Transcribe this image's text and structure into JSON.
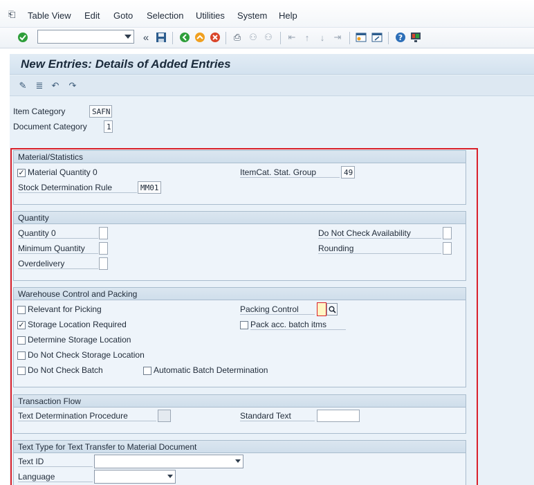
{
  "menu": {
    "items": [
      "Table View",
      "Edit",
      "Goto",
      "Selection",
      "Utilities",
      "System",
      "Help"
    ]
  },
  "toolbar": {
    "icons": [
      "checkmark-icon",
      "back-chevrons-icon",
      "save-icon",
      "back-icon",
      "exit-icon",
      "cancel-icon",
      "print-icon",
      "find-icon",
      "find-next-icon",
      "first-page-icon",
      "prev-page-icon",
      "next-page-icon",
      "last-page-icon",
      "new-session-icon",
      "shortcut-icon",
      "help-icon",
      "customize-layout-icon"
    ],
    "command_value": ""
  },
  "title": "New Entries: Details of Added Entries",
  "header_fields": {
    "item_category": {
      "label": "Item Category",
      "value": "SAFN"
    },
    "document_category": {
      "label": "Document Category",
      "value": "1"
    }
  },
  "material_statistics": {
    "header": "Material/Statistics",
    "material_quantity_0": {
      "label": "Material Quantity 0",
      "checked": true
    },
    "itemcat_stat_group": {
      "label": "ItemCat. Stat. Group",
      "value": "49"
    },
    "stock_determination_rule": {
      "label": "Stock Determination Rule",
      "value": "MM01"
    }
  },
  "quantity": {
    "header": "Quantity",
    "quantity_0": {
      "label": "Quantity 0",
      "value": ""
    },
    "minimum_quantity": {
      "label": "Minimum Quantity",
      "value": ""
    },
    "overdelivery": {
      "label": "Overdelivery",
      "value": ""
    },
    "do_not_check_availability": {
      "label": "Do Not Check Availability",
      "value": ""
    },
    "rounding": {
      "label": "Rounding",
      "value": ""
    }
  },
  "warehouse": {
    "header": "Warehouse Control and Packing",
    "relevant_for_picking": {
      "label": "Relevant for Picking",
      "checked": false
    },
    "storage_location_required": {
      "label": "Storage Location Required",
      "checked": true
    },
    "determine_storage_location": {
      "label": "Determine Storage Location",
      "checked": false
    },
    "do_not_check_storage_location": {
      "label": "Do Not Check Storage Location",
      "checked": false
    },
    "do_not_check_batch": {
      "label": "Do Not Check Batch",
      "checked": false
    },
    "automatic_batch_determination": {
      "label": "Automatic Batch Determination",
      "checked": false
    },
    "packing_control": {
      "label": "Packing Control",
      "value": ""
    },
    "pack_acc_batch_itms": {
      "label": "Pack acc. batch itms",
      "checked": false
    }
  },
  "transaction_flow": {
    "header": "Transaction Flow",
    "text_determination_procedure": {
      "label": "Text Determination Procedure",
      "value": ""
    },
    "standard_text": {
      "label": "Standard Text",
      "value": ""
    }
  },
  "text_type": {
    "header": "Text Type for Text Transfer to Material Document",
    "text_id": {
      "label": "Text ID",
      "value": ""
    },
    "language": {
      "label": "Language",
      "value": ""
    }
  },
  "colors": {
    "highlight_frame": "#d9202a",
    "background": "#e9f1f8",
    "group_header": "#cfdeeb"
  }
}
